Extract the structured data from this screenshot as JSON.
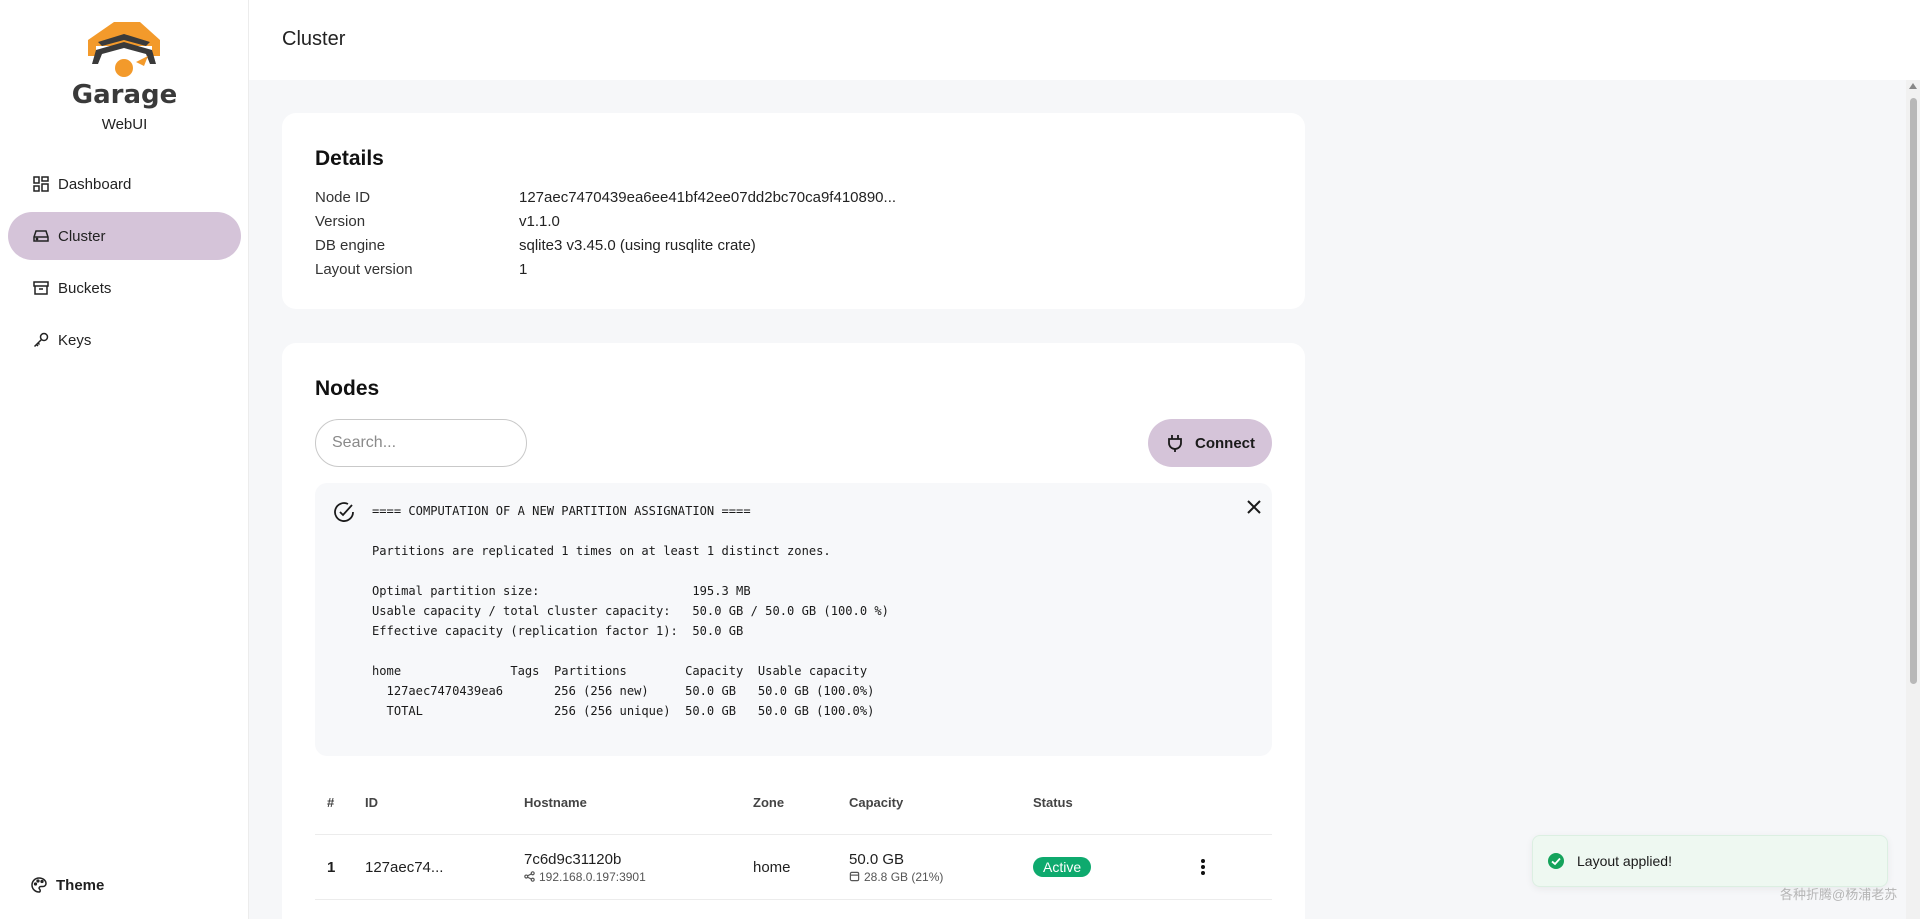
{
  "app": {
    "logo_name": "Garage",
    "logo_sub": "WebUI"
  },
  "sidebar": {
    "items": [
      {
        "label": "Dashboard",
        "icon": "dashboard-icon"
      },
      {
        "label": "Cluster",
        "icon": "drive-icon",
        "active": true
      },
      {
        "label": "Buckets",
        "icon": "archive-icon"
      },
      {
        "label": "Keys",
        "icon": "key-icon"
      }
    ],
    "theme_label": "Theme"
  },
  "header": {
    "title": "Cluster"
  },
  "details": {
    "title": "Details",
    "rows": [
      {
        "label": "Node ID",
        "value": "127aec7470439ea6ee41bf42ee07dd2bc70ca9f410890..."
      },
      {
        "label": "Version",
        "value": "v1.1.0"
      },
      {
        "label": "DB engine",
        "value": "sqlite3 v3.45.0 (using rusqlite crate)"
      },
      {
        "label": "Layout version",
        "value": "1"
      }
    ]
  },
  "nodes": {
    "title": "Nodes",
    "search_placeholder": "Search...",
    "connect_label": "Connect",
    "notice_text": "==== COMPUTATION OF A NEW PARTITION ASSIGNATION ====\n\nPartitions are replicated 1 times on at least 1 distinct zones.\n\nOptimal partition size:                     195.3 MB\nUsable capacity / total cluster capacity:   50.0 GB / 50.0 GB (100.0 %)\nEffective capacity (replication factor 1):  50.0 GB\n\nhome               Tags  Partitions        Capacity  Usable capacity\n  127aec7470439ea6       256 (256 new)     50.0 GB   50.0 GB (100.0%)\n  TOTAL                  256 (256 unique)  50.0 GB   50.0 GB (100.0%)",
    "columns": [
      "#",
      "ID",
      "Hostname",
      "Zone",
      "Capacity",
      "Status"
    ],
    "rows": [
      {
        "num": "1",
        "id": "127aec74...",
        "hostname": "7c6d9c31120b",
        "address": "192.168.0.197:3901",
        "zone": "home",
        "capacity": "50.0 GB",
        "usage": "28.8 GB (21%)",
        "status": "Active"
      }
    ]
  },
  "toast": {
    "message": "Layout applied!"
  },
  "watermark": "各种折腾@杨浦老苏",
  "colors": {
    "accent": "#d5c4d9",
    "status_active": "#0eaa6e",
    "logo_orange": "#f39a2b"
  }
}
